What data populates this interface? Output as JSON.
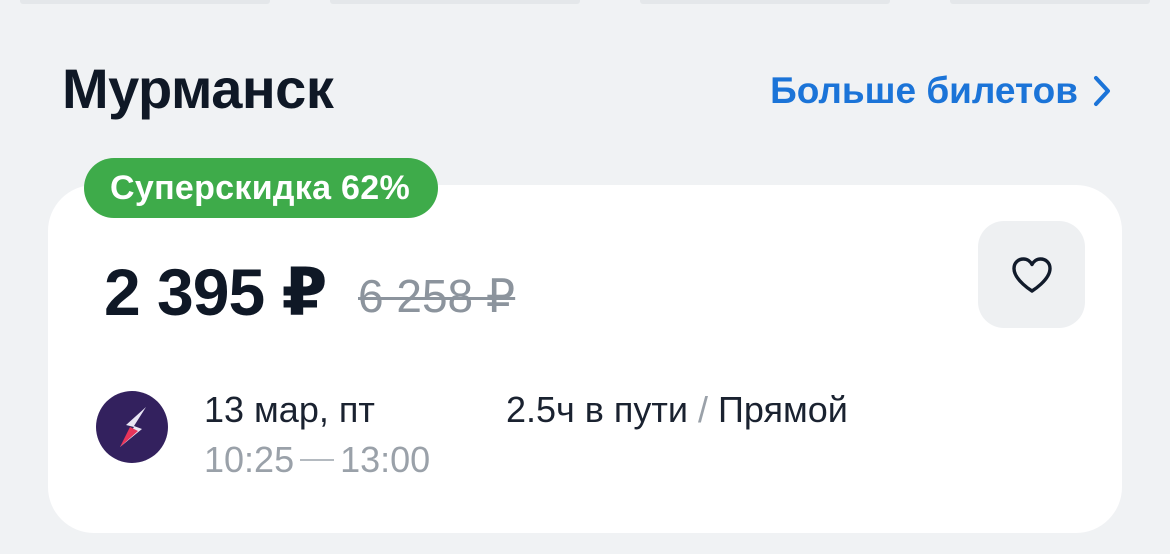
{
  "header": {
    "city": "Мурманск",
    "more_link": "Больше билетов"
  },
  "offer": {
    "badge": "Суперскидка 62%",
    "price": "2 395 ₽",
    "old_price": "6 258 ₽",
    "flight": {
      "date": "13 мар, пт",
      "departure": "10:25",
      "arrival": "13:00",
      "duration": "2.5ч в пути",
      "separator": "/",
      "stops": "Прямой"
    }
  },
  "colors": {
    "accent": "#1b74d8",
    "discount_badge": "#3eab4a",
    "airline_logo_bg": "#33215e"
  },
  "icons": {
    "more_link_icon": "chevron-right-icon",
    "favorite": "heart-icon",
    "airline": "airline-logo"
  }
}
